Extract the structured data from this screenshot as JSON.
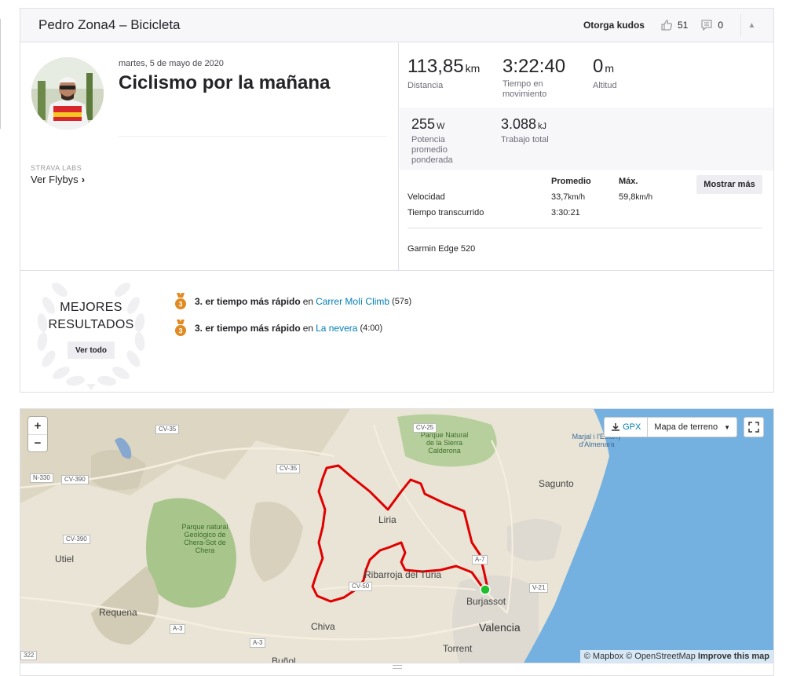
{
  "header": {
    "title": "Pedro Zona4 – Bicicleta",
    "kudos_button": "Otorga kudos",
    "kudos_count": "51",
    "comments_count": "0"
  },
  "activity": {
    "date": "martes, 5 de mayo de 2020",
    "name": "Ciclismo por la mañana",
    "labs_label": "STRAVA LABS",
    "flybys_link": "Ver Flybys"
  },
  "stats": {
    "distance": {
      "value": "113,85",
      "unit": "km",
      "label": "Distancia"
    },
    "moving_time": {
      "value": "3:22:40",
      "label": "Tiempo en movimiento"
    },
    "elevation": {
      "value": "0",
      "unit": "m",
      "label": "Altitud"
    },
    "weighted_power": {
      "value": "255",
      "unit": "W",
      "label": "Potencia promedio ponderada"
    },
    "total_work": {
      "value": "3.088",
      "unit": "kJ",
      "label": "Trabajo total"
    }
  },
  "more_stats": {
    "col_avg": "Promedio",
    "col_max": "Máx.",
    "show_more": "Mostrar más",
    "speed_label": "Velocidad",
    "speed_avg": "33,7",
    "speed_max": "59,8",
    "speed_unit": "km/h",
    "elapsed_label": "Tiempo transcurrido",
    "elapsed_avg": "3:30:21",
    "device": "Garmin Edge 520"
  },
  "best_results": {
    "title_line1": "MEJORES",
    "title_line2": "RESULTADOS",
    "view_all": "Ver todo",
    "items": [
      {
        "rank_text": "3. er tiempo más rápido",
        "conn": "en",
        "segment": "Carrer Molí Climb",
        "time": "(57s)",
        "medal_num": "3"
      },
      {
        "rank_text": "3. er tiempo más rápido",
        "conn": "en",
        "segment": "La nevera",
        "time": "(4:00)",
        "medal_num": "3"
      }
    ]
  },
  "map": {
    "zoom_in": "+",
    "zoom_out": "−",
    "gpx": "GPX",
    "map_type": "Mapa de terreno",
    "attribution_1": "© Mapbox © OpenStreetMap",
    "attribution_2": "Improve this map",
    "labels": {
      "park1": "Parque Natural de la Sierra Calderona",
      "park2": "Parque natural Geológico de Chera-Sot de Chera",
      "marjal": "Marjal i l'Estany d'Almenara",
      "sagunto": "Sagunto",
      "liria": "Liria",
      "ribarroja": "Ribarroja del Turia",
      "burjassot": "Burjassot",
      "valencia": "Valencia",
      "utiel": "Utiel",
      "requena": "Requena",
      "chiva": "Chiva",
      "torrent": "Torrent",
      "bunol": "Buñol"
    },
    "roads": {
      "r1": "CV-35",
      "r2": "CV-35",
      "r3": "CV-25",
      "r4": "N-330",
      "r5": "CV-390",
      "r6": "CV-390",
      "r7": "A-7",
      "r8": "CV-50",
      "r9": "V-21",
      "r10": "A-3",
      "r11": "A-3",
      "r12": "322"
    },
    "colors": {
      "route": "#e00000",
      "sea": "#75b1e0",
      "land": "#e9e4d6",
      "forest": "#a8c58b",
      "start_marker": "#1fbf2c"
    }
  },
  "colors": {
    "link": "#007fb6",
    "medal": "#e08a20"
  }
}
